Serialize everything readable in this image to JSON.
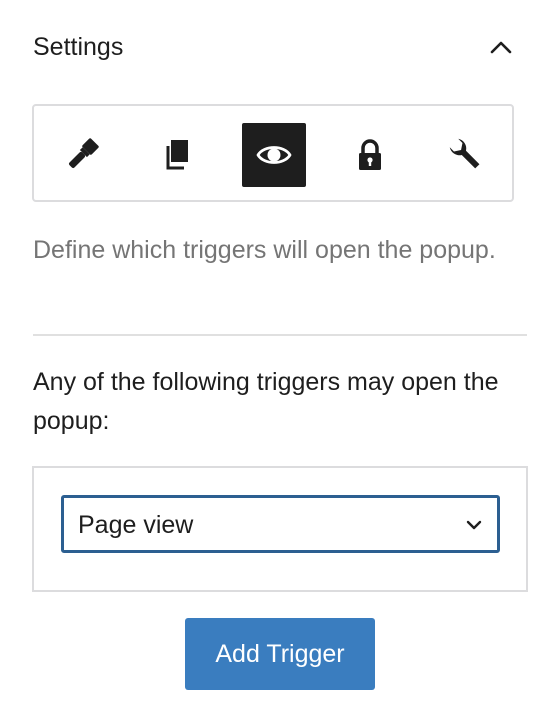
{
  "header": {
    "title": "Settings",
    "collapse_icon": "chevron-up-icon"
  },
  "tabs": [
    {
      "icon": "paintbrush-icon",
      "active": false
    },
    {
      "icon": "copy-pages-icon",
      "active": false
    },
    {
      "icon": "eye-icon",
      "active": true
    },
    {
      "icon": "lock-icon",
      "active": false
    },
    {
      "icon": "wrench-icon",
      "active": false
    }
  ],
  "description": "Define which triggers will open the popup.",
  "intro": "Any of the following triggers may open the popup:",
  "trigger_select": {
    "value": "Page view",
    "icon": "chevron-down-icon"
  },
  "add_trigger_label": "Add Trigger",
  "colors": {
    "active_tab": "#1e1e1e",
    "select_border": "#2c5f91",
    "button_bg": "#3a7dbf",
    "muted_text": "#757575"
  }
}
